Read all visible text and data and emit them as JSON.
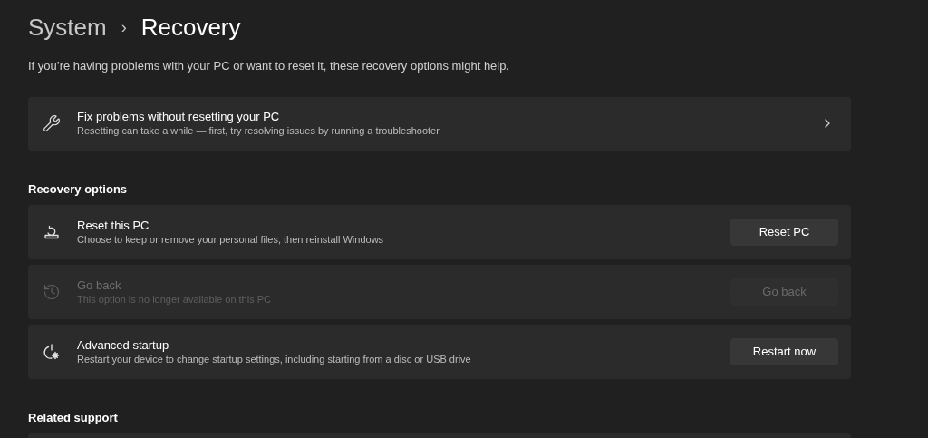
{
  "breadcrumb": {
    "parent": "System",
    "separator": "›",
    "current": "Recovery"
  },
  "description": "If you’re having problems with your PC or want to reset it, these recovery options might help.",
  "fix_card": {
    "title": "Fix problems without resetting your PC",
    "subtitle": "Resetting can take a while — first, try resolving issues by running a troubleshooter"
  },
  "recovery_options": {
    "heading": "Recovery options",
    "items": [
      {
        "title": "Reset this PC",
        "subtitle": "Choose to keep or remove your personal files, then reinstall Windows",
        "button": "Reset PC",
        "disabled": false
      },
      {
        "title": "Go back",
        "subtitle": "This option is no longer available on this PC",
        "button": "Go back",
        "disabled": true
      },
      {
        "title": "Advanced startup",
        "subtitle": "Restart your device to change startup settings, including starting from a disc or USB drive",
        "button": "Restart now",
        "disabled": false
      }
    ]
  },
  "related_support": {
    "heading": "Related support"
  }
}
